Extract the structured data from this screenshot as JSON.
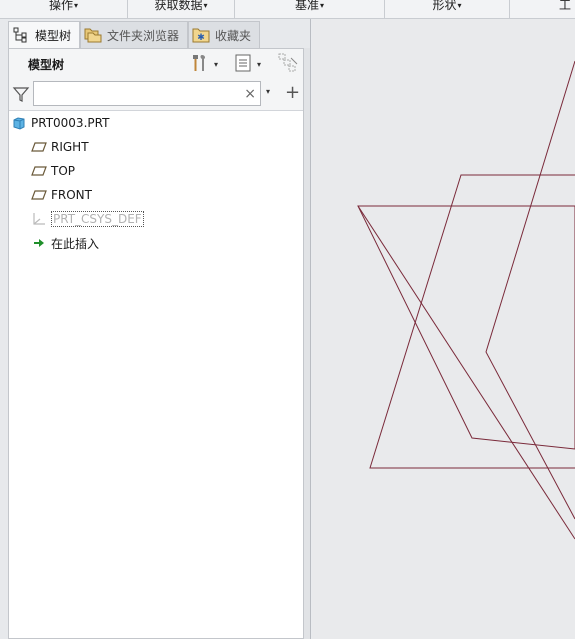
{
  "ribbon": {
    "groups": [
      {
        "label": "操作",
        "caret": "▾"
      },
      {
        "label": "获取数据",
        "caret": "▾"
      },
      {
        "label": "基准",
        "caret": "▾"
      },
      {
        "label": "形状",
        "caret": "▾"
      },
      {
        "label": "工",
        "caret": ""
      }
    ]
  },
  "tabs": [
    {
      "label": "模型树",
      "icon": "model-tree-icon",
      "active": true
    },
    {
      "label": "文件夹浏览器",
      "icon": "folder-browser-icon",
      "active": false
    },
    {
      "label": "收藏夹",
      "icon": "favorites-icon",
      "active": false
    }
  ],
  "tree_panel": {
    "title": "模型树",
    "search": {
      "value": "",
      "placeholder": "",
      "clear": "×"
    },
    "filter_dropdown": "▾",
    "add_symbol": "+",
    "tool_dropdown": "▾"
  },
  "tree": {
    "root": {
      "label": "PRT0003.PRT",
      "icon": "part-icon"
    },
    "items": [
      {
        "label": "RIGHT",
        "icon": "datum-plane-icon"
      },
      {
        "label": "TOP",
        "icon": "datum-plane-icon"
      },
      {
        "label": "FRONT",
        "icon": "datum-plane-icon"
      },
      {
        "label": "PRT_CSYS_DEF",
        "icon": "coordinate-system-icon"
      },
      {
        "label": "在此插入",
        "icon": "insert-here-arrow-icon"
      }
    ]
  },
  "colors": {
    "datum_line": "#7a2a3a",
    "insert_arrow": "#1f8f2a",
    "part_icon": "#4aa3d8"
  }
}
